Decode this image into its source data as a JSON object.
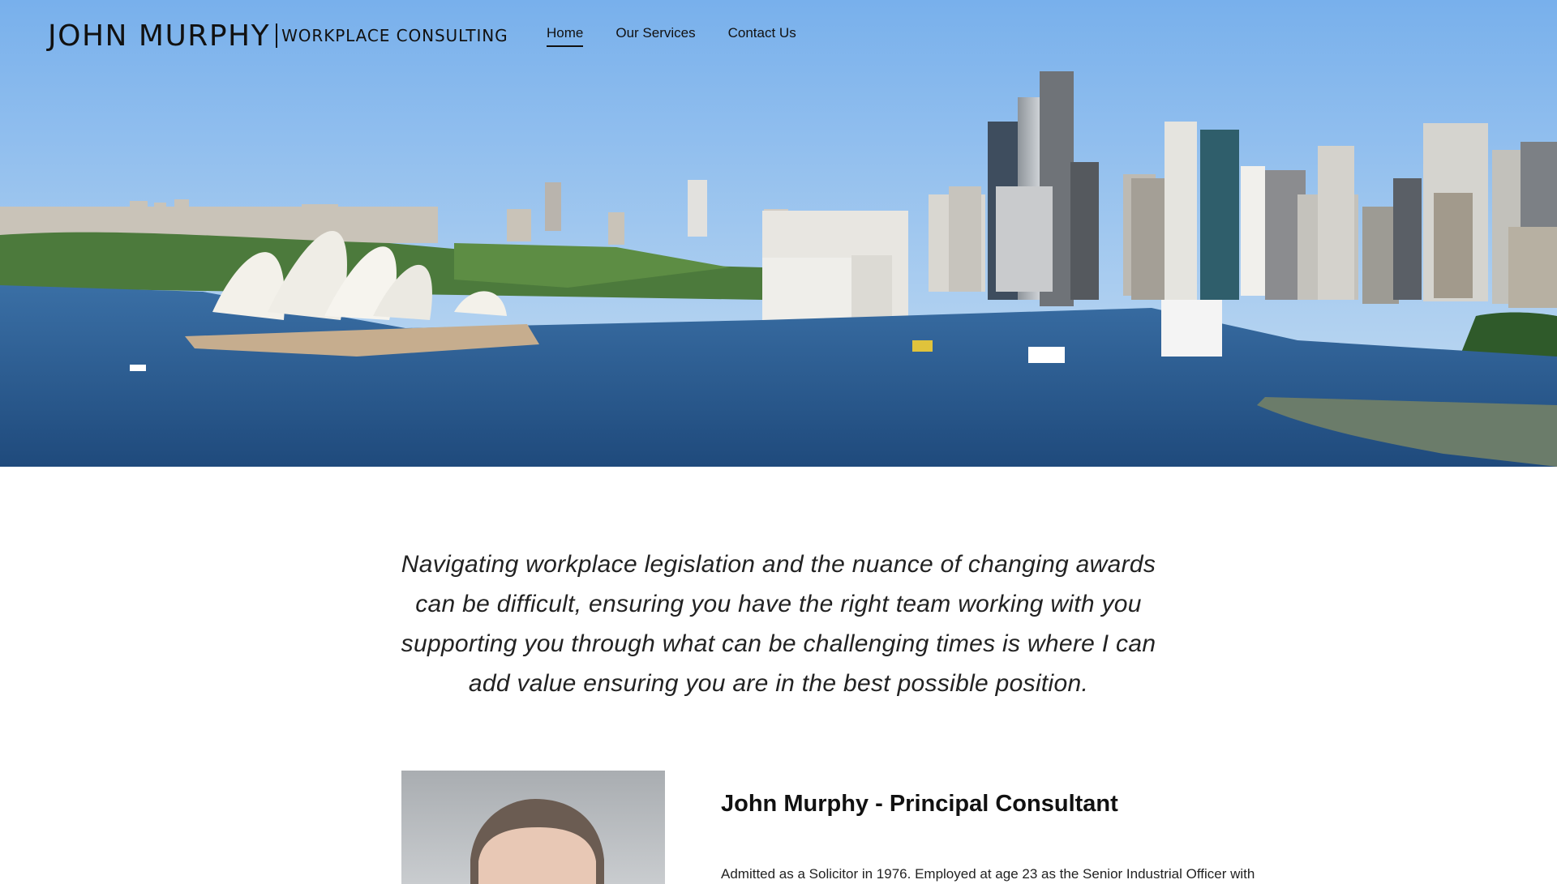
{
  "header": {
    "brand_name": "JOHN MURPHY",
    "brand_sub": "WORKPLACE CONSULTING",
    "nav": [
      {
        "label": "Home",
        "active": true
      },
      {
        "label": "Our Services",
        "active": false
      },
      {
        "label": "Contact Us",
        "active": false
      }
    ]
  },
  "hero": {
    "image": "sydney-harbour-panorama",
    "sky_color": "#7db4ee",
    "water_color": "#2e5f95"
  },
  "intro": {
    "text": "Navigating workplace legislation and the nuance of changing awards can be difficult, ensuring you have the right team working with you supporting you through what can be challenging times is where I can add value ensuring you are in the best possible position."
  },
  "profile": {
    "portrait": "john-murphy-portrait",
    "title": "John Murphy - Principal Consultant",
    "text": "Admitted as a Solicitor in 1976. Employed at age 23 as the Senior Industrial Officer with"
  }
}
